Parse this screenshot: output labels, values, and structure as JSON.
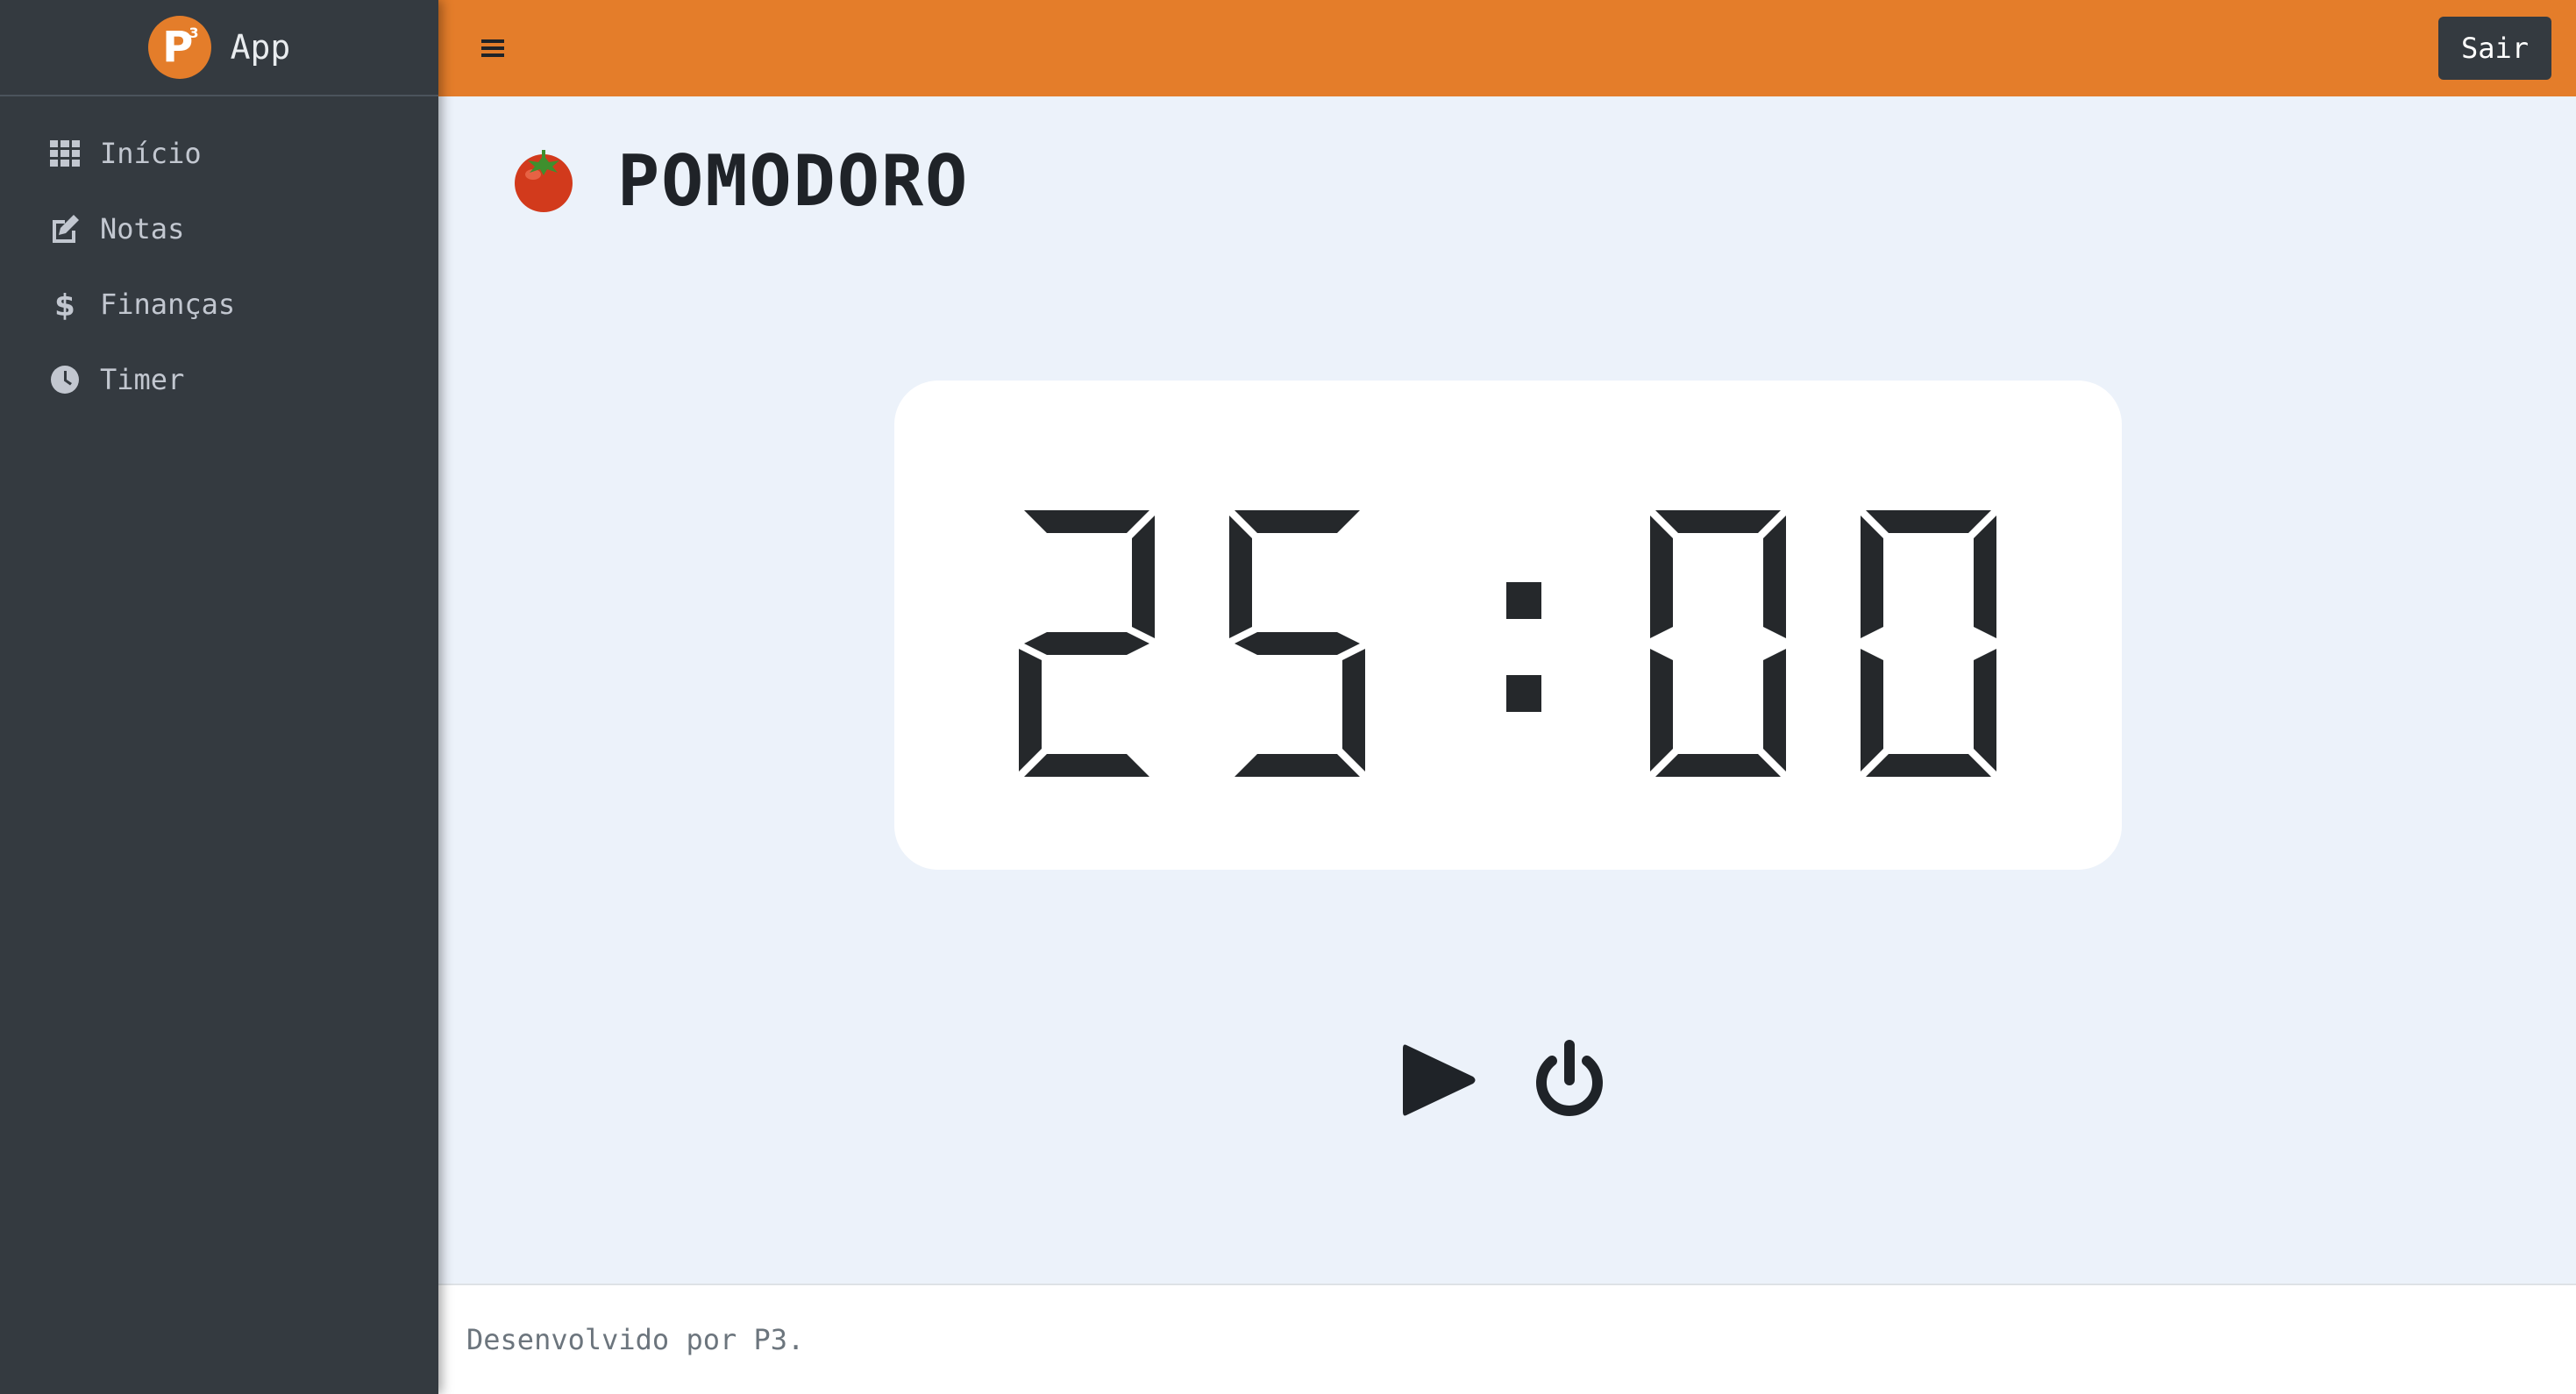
{
  "brand": {
    "name": "App",
    "logo_letter": "P",
    "logo_superscript": "3",
    "logo_color": "#e47d2a"
  },
  "sidebar": {
    "background": "#343a40",
    "items": [
      {
        "label": "Início",
        "icon": "grid-icon"
      },
      {
        "label": "Notas",
        "icon": "edit-icon"
      },
      {
        "label": "Finanças",
        "icon": "dollar-icon"
      },
      {
        "label": "Timer",
        "icon": "clock-icon"
      }
    ]
  },
  "topbar": {
    "background": "#e47d2a",
    "menu_icon": "hamburger-icon",
    "logout_label": "Sair"
  },
  "page": {
    "title": "POMODORO",
    "title_icon": "tomato-icon",
    "background": "#ecf2fa"
  },
  "timer": {
    "display": "25:00",
    "minutes": "25",
    "seconds": "00"
  },
  "controls": {
    "play_icon": "play-icon",
    "power_icon": "power-icon"
  },
  "footer": {
    "text": "Desenvolvido por P3."
  }
}
